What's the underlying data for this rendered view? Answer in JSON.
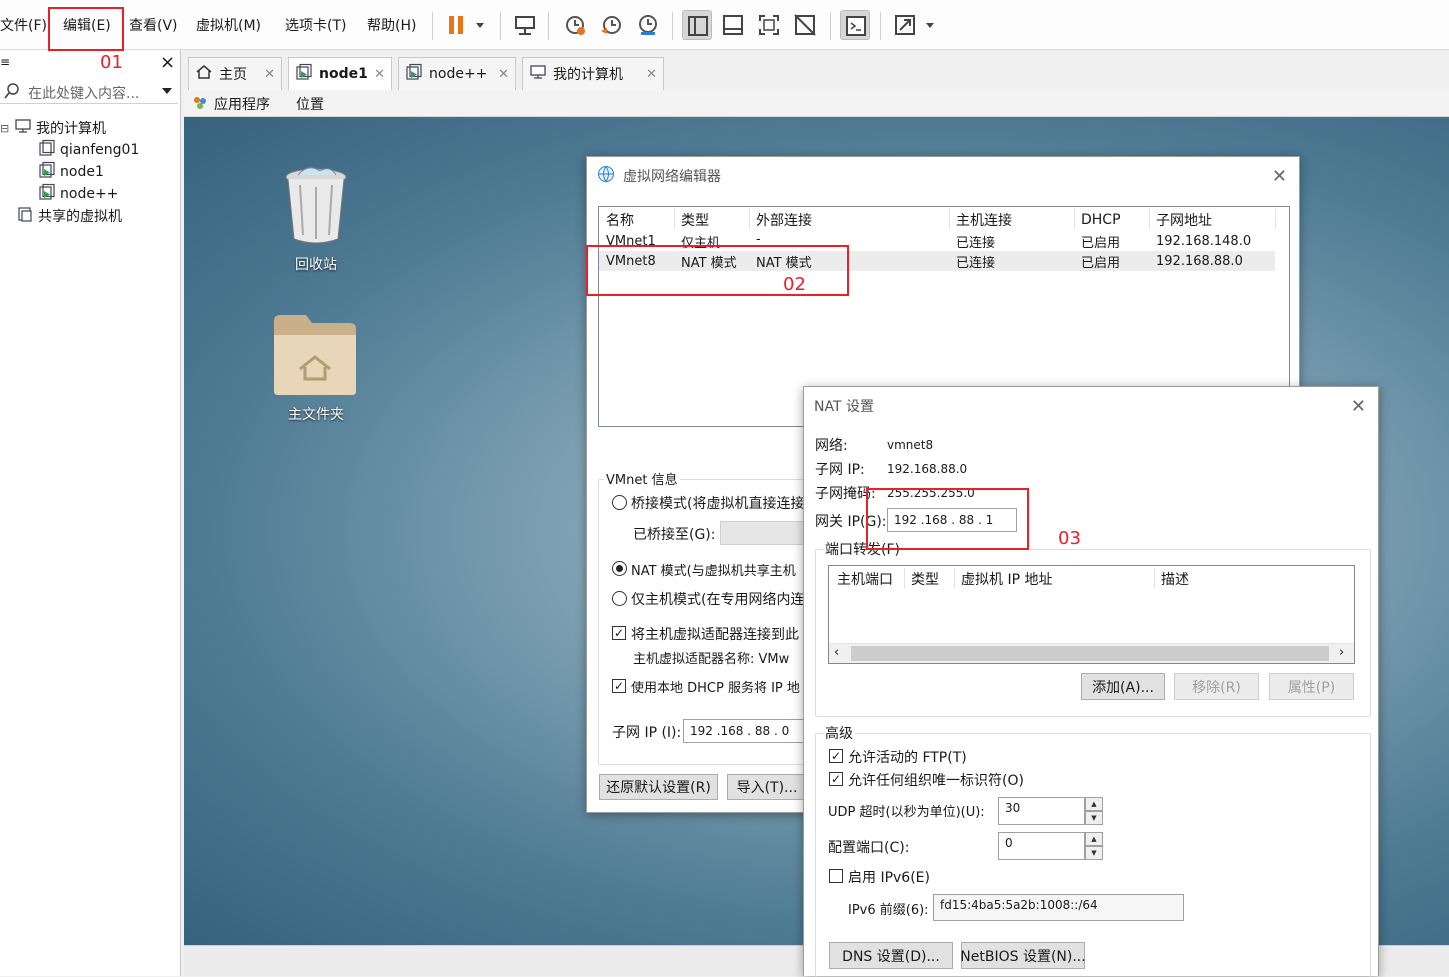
{
  "menu": {
    "items": [
      "文件(F)",
      "编辑(E)",
      "查看(V)",
      "虚拟机(M)",
      "选项卡(T)",
      "帮助(H)"
    ]
  },
  "toolbar": {
    "icons": [
      "pause-icon",
      "dropdown-arrow-icon",
      "send-ctrl-alt-del-icon",
      "snapshot-take-icon",
      "snapshot-revert-icon",
      "snapshot-manager-icon",
      "library-view-icon",
      "thumbnail-bar-icon",
      "full-screen-icon",
      "unity-off-icon",
      "console-view-icon",
      "stretch-view-icon",
      "dropdown-arrow-icon"
    ]
  },
  "library": {
    "close": "×",
    "search_placeholder": "在此处键入内容...",
    "tree": [
      {
        "label": "我的计算机",
        "level": 0,
        "icon": "computer-icon"
      },
      {
        "label": "qianfeng01",
        "level": 1,
        "icon": "vm-off-icon"
      },
      {
        "label": "node1",
        "level": 1,
        "icon": "vm-running-icon"
      },
      {
        "label": "node++",
        "level": 1,
        "icon": "vm-running-icon"
      },
      {
        "label": "共享的虚拟机",
        "level": 0,
        "icon": "shared-vm-icon"
      }
    ]
  },
  "tabs": [
    {
      "label": "主页",
      "icon": "home-icon"
    },
    {
      "label": "node1",
      "icon": "vm-running-icon",
      "active": true
    },
    {
      "label": "node++",
      "icon": "vm-running-icon"
    },
    {
      "label": "我的计算机",
      "icon": "computer-icon"
    }
  ],
  "guest": {
    "menu": [
      "应用程序",
      "位置"
    ],
    "desktop_icons": [
      "回收站",
      "主文件夹"
    ]
  },
  "vne": {
    "title": "虚拟网络编辑器",
    "columns": [
      "名称",
      "类型",
      "外部连接",
      "主机连接",
      "DHCP",
      "子网地址"
    ],
    "rows": [
      [
        "VMnet1",
        "仅主机",
        "-",
        "已连接",
        "已启用",
        "192.168.148.0"
      ],
      [
        "VMnet8",
        "NAT 模式",
        "NAT 模式",
        "已连接",
        "已启用",
        "192.168.88.0"
      ]
    ],
    "vmnet_info": "VMnet 信息",
    "bridged": "桥接模式(将虚拟机直接连接",
    "bridged_to": "已桥接至(G):",
    "nat": "NAT 模式(与虚拟机共享主机",
    "hostonly": "仅主机模式(在专用网络内连",
    "connect_adapter": "将主机虚拟适配器连接到此",
    "adapter_name": "主机虚拟适配器名称: VMw",
    "dhcp": "使用本地 DHCP 服务将 IP 地",
    "subnet_ip_label": "子网 IP (I):",
    "subnet_ip_value": "192 .168 . 88 .  0",
    "restore_btn": "还原默认设置(R)",
    "import_btn": "导入(T)..."
  },
  "nat": {
    "title": "NAT 设置",
    "network_label": "网络:",
    "network_value": "vmnet8",
    "subnet_ip_label": "子网 IP:",
    "subnet_ip_value": "192.168.88.0",
    "mask_label": "子网掩码:",
    "mask_value": "255.255.255.0",
    "gateway_label": "网关 IP(G):",
    "gateway_value": "192 .168 . 88  .  1",
    "port_forward": "端口转发(F)",
    "pf_columns": [
      "主机端口",
      "类型",
      "虚拟机 IP 地址",
      "描述"
    ],
    "add_btn": "添加(A)...",
    "remove_btn": "移除(R)",
    "props_btn": "属性(P)",
    "advanced": "高级",
    "allow_ftp": "允许活动的 FTP(T)",
    "allow_uid": "允许任何组织唯一标识符(O)",
    "udp_label": "UDP 超时(以秒为单位)(U):",
    "udp_value": "30",
    "config_port_label": "配置端口(C):",
    "config_port_value": "0",
    "ipv6_enable": "启用 IPv6(E)",
    "ipv6_prefix_label": "IPv6 前缀(6):",
    "ipv6_prefix_value": "fd15:4ba5:5a2b:1008::/64",
    "dns_btn": "DNS 设置(D)...",
    "netbios_btn": "NetBIOS 设置(N)..."
  },
  "annotations": [
    "01",
    "02",
    "03"
  ],
  "colors": {
    "annotation": "#e8202a",
    "pause": "#e8751a",
    "desktop": "#4d7993"
  }
}
